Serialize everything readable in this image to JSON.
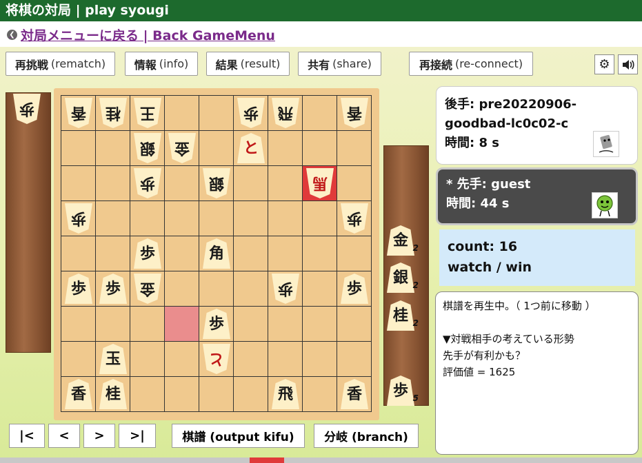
{
  "header": {
    "title": "将棋の対局 | play syougi",
    "back_link": "対局メニューに戻る | Back GameMenu"
  },
  "toolbar": {
    "buttons": [
      {
        "ja": "再挑戦",
        "en": "(rematch)"
      },
      {
        "ja": "情報",
        "en": "(info)"
      },
      {
        "ja": "結果",
        "en": "(result)"
      },
      {
        "ja": "共有",
        "en": "(share)"
      },
      {
        "ja": "再接続",
        "en": "(re-connect)"
      }
    ],
    "settings_icon": "gear-icon",
    "sound_icon": "speaker-icon"
  },
  "board": {
    "pieces": [
      {
        "file": 9,
        "rank": 1,
        "char": "香",
        "side": "gote"
      },
      {
        "file": 8,
        "rank": 1,
        "char": "桂",
        "side": "gote"
      },
      {
        "file": 7,
        "rank": 1,
        "char": "王",
        "side": "gote"
      },
      {
        "file": 4,
        "rank": 1,
        "char": "歩",
        "side": "gote"
      },
      {
        "file": 3,
        "rank": 1,
        "char": "飛",
        "side": "gote"
      },
      {
        "file": 1,
        "rank": 1,
        "char": "香",
        "side": "gote"
      },
      {
        "file": 7,
        "rank": 2,
        "char": "銀",
        "side": "gote"
      },
      {
        "file": 6,
        "rank": 2,
        "char": "金",
        "side": "gote"
      },
      {
        "file": 4,
        "rank": 2,
        "char": "と",
        "side": "sente",
        "promoted": true
      },
      {
        "file": 7,
        "rank": 3,
        "char": "歩",
        "side": "gote"
      },
      {
        "file": 5,
        "rank": 3,
        "char": "銀",
        "side": "gote"
      },
      {
        "file": 2,
        "rank": 3,
        "char": "馬",
        "side": "gote",
        "promoted": true
      },
      {
        "file": 9,
        "rank": 4,
        "char": "歩",
        "side": "gote"
      },
      {
        "file": 1,
        "rank": 4,
        "char": "歩",
        "side": "gote"
      },
      {
        "file": 7,
        "rank": 5,
        "char": "歩",
        "side": "sente"
      },
      {
        "file": 5,
        "rank": 5,
        "char": "角",
        "side": "sente"
      },
      {
        "file": 9,
        "rank": 6,
        "char": "歩",
        "side": "sente"
      },
      {
        "file": 8,
        "rank": 6,
        "char": "歩",
        "side": "sente"
      },
      {
        "file": 7,
        "rank": 6,
        "char": "金",
        "side": "gote"
      },
      {
        "file": 3,
        "rank": 6,
        "char": "歩",
        "side": "gote"
      },
      {
        "file": 1,
        "rank": 6,
        "char": "歩",
        "side": "sente"
      },
      {
        "file": 5,
        "rank": 7,
        "char": "歩",
        "side": "sente"
      },
      {
        "file": 5,
        "rank": 8,
        "char": "と",
        "side": "gote",
        "promoted": true
      },
      {
        "file": 8,
        "rank": 8,
        "char": "玉",
        "side": "sente"
      },
      {
        "file": 9,
        "rank": 9,
        "char": "香",
        "side": "sente"
      },
      {
        "file": 8,
        "rank": 9,
        "char": "桂",
        "side": "sente"
      },
      {
        "file": 3,
        "rank": 9,
        "char": "飛",
        "side": "sente"
      },
      {
        "file": 1,
        "rank": 9,
        "char": "香",
        "side": "sente"
      }
    ],
    "last_move_to": {
      "file": 2,
      "rank": 3
    },
    "last_move_from": {
      "file": 6,
      "rank": 7
    }
  },
  "hands": {
    "gote": [
      {
        "char": "歩",
        "count": ""
      }
    ],
    "sente": [
      {
        "char": "金",
        "count": "2"
      },
      {
        "char": "銀",
        "count": "2"
      },
      {
        "char": "桂",
        "count": "2"
      },
      {
        "char": "歩",
        "count": "5"
      }
    ]
  },
  "players": {
    "gote": {
      "label": "後手:",
      "name_line1": "pre20220906-",
      "name_line2": "goodbad-lc0c02-c",
      "time_label": "時間:",
      "time": "8 s"
    },
    "sente": {
      "label": "* 先手:",
      "name": "guest",
      "time_label": "時間:",
      "time": "44 s"
    }
  },
  "stats": {
    "count": "count: 16",
    "watch": "watch / win"
  },
  "message": {
    "line1": "棋譜を再生中。（ 1つ前に移動 ）",
    "line2": "▼対戦相手の考えている形勢",
    "line3": "先手が有利かも？",
    "line4": "評価値 = 1625"
  },
  "nav": {
    "first": "|<",
    "prev": "<",
    "next": ">",
    "last": ">|",
    "kifu": "棋譜 (output kifu)",
    "branch": "分岐 (branch)"
  }
}
